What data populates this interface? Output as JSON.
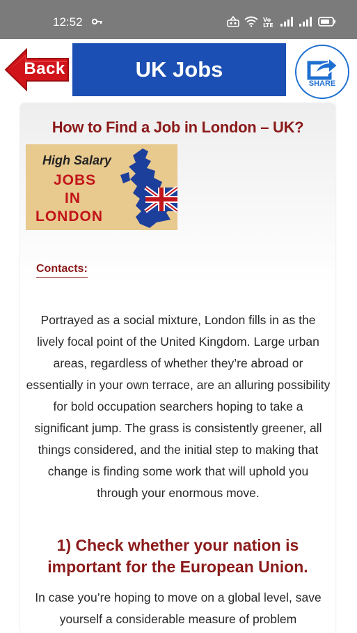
{
  "status_bar": {
    "time": "12:52",
    "icons": [
      "key-icon",
      "network-icon",
      "wifi-icon",
      "volte-icon",
      "signal-icon",
      "signal-icon",
      "battery-icon"
    ]
  },
  "header": {
    "back_label": "Back",
    "title": "UK Jobs",
    "share_label": "SHARE"
  },
  "article": {
    "title": "How to Find a Job in London – UK?",
    "banner": {
      "line1": "High Salary",
      "line2": "JOBS",
      "line3": "IN",
      "line4": "LONDON"
    },
    "contacts_label": "Contacts:",
    "paragraph1": "Portrayed as a social mixture, London fills in as the lively focal point of the United Kingdom. Large urban areas, regardless of whether they’re abroad or essentially in your own terrace, are an alluring possibility for bold occupation searchers hoping to take a significant jump. The grass is consistently greener, all things considered, and the initial step to making that change is finding some work that will uphold you through your enormous move.",
    "section1_heading": "1) Check whether your nation is important for the European Union.",
    "paragraph2": "In case you’re hoping to move on a global level, save yourself a considerable measure of problem"
  },
  "colors": {
    "status_bar": "#7b7b7b",
    "title_bar": "#1b4fb3",
    "back_button": "#d0141a",
    "accent_text": "#8b1a1a",
    "share": "#1f6fd1"
  }
}
